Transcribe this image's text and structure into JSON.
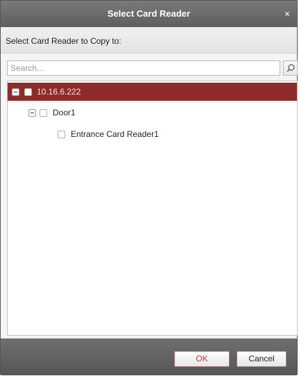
{
  "dialog": {
    "title": "Select Card Reader",
    "close_symbol": "×",
    "subheader": "Select Card Reader to Copy to:"
  },
  "search": {
    "placeholder": "Search...",
    "value": "",
    "icon": "search-icon"
  },
  "tree": {
    "device": {
      "label": "10.16.6.222",
      "expanded": true,
      "selected": true,
      "checked": false
    },
    "door": {
      "label": "Door1",
      "expanded": true,
      "checked": false
    },
    "reader": {
      "label": "Entrance Card Reader1",
      "checked": false
    }
  },
  "buttons": {
    "ok": "OK",
    "cancel": "Cancel"
  },
  "colors": {
    "titlebar": "#666666",
    "selected_row": "#8e2c2c",
    "footer": "#606060",
    "ok_text": "#c0392b"
  }
}
